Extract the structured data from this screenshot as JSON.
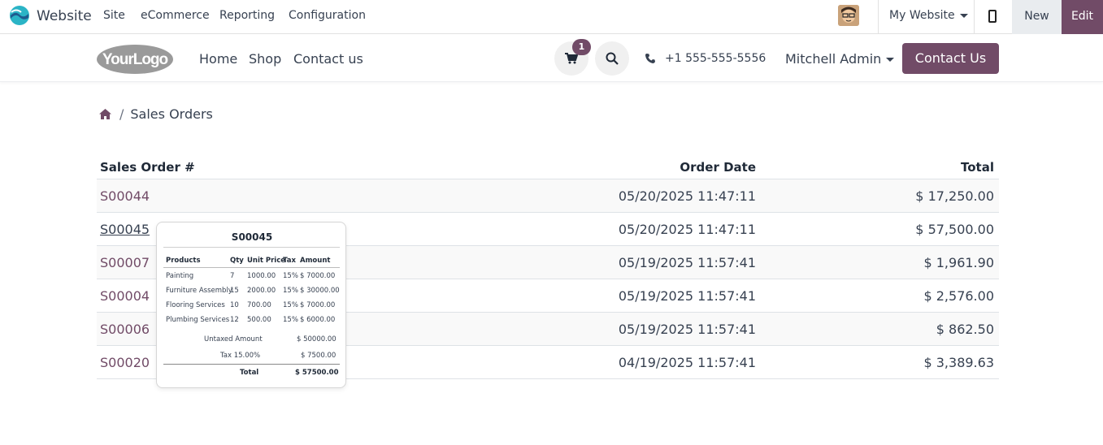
{
  "admin": {
    "app_name": "Website",
    "menu": [
      "Site",
      "eCommerce",
      "Reporting",
      "Configuration"
    ],
    "website_selector": "My Website",
    "new_label": "New",
    "edit_label": "Edit"
  },
  "header": {
    "logo_text": "YourLogo",
    "nav": [
      "Home",
      "Shop",
      "Contact us"
    ],
    "cart_count": "1",
    "phone": "+1 555-555-5556",
    "user": "Mitchell Admin",
    "contact_button": "Contact Us"
  },
  "breadcrumb": {
    "current": "Sales Orders"
  },
  "table": {
    "headers": [
      "Sales Order #",
      "Order Date",
      "Total"
    ],
    "rows": [
      {
        "order": "S00044",
        "date": "05/20/2025  11:47:11",
        "total": "$ 17,250.00"
      },
      {
        "order": "S00045",
        "date": "05/20/2025  11:47:11",
        "total": "$ 57,500.00"
      },
      {
        "order": "S00007",
        "date": "05/19/2025  11:57:41",
        "total": "$ 1,961.90"
      },
      {
        "order": "S00004",
        "date": "05/19/2025  11:57:41",
        "total": "$ 2,576.00"
      },
      {
        "order": "S00006",
        "date": "05/19/2025  11:57:41",
        "total": "$ 862.50"
      },
      {
        "order": "S00020",
        "date": "04/19/2025  11:57:41",
        "total": "$ 3,389.63"
      }
    ]
  },
  "popover": {
    "title": "S00045",
    "headers": [
      "Products",
      "Qty",
      "Unit Price",
      "Tax",
      "Amount"
    ],
    "lines": [
      {
        "product": "Painting",
        "qty": "7",
        "price": "1000.00",
        "tax": "15%",
        "amount": "$ 7000.00"
      },
      {
        "product": "Furniture Assembly",
        "qty": "15",
        "price": "2000.00",
        "tax": "15%",
        "amount": "$ 30000.00"
      },
      {
        "product": "Flooring Services",
        "qty": "10",
        "price": "700.00",
        "tax": "15%",
        "amount": "$ 7000.00"
      },
      {
        "product": "Plumbing Services",
        "qty": "12",
        "price": "500.00",
        "tax": "15%",
        "amount": "$ 6000.00"
      }
    ],
    "untaxed_label": "Untaxed Amount",
    "untaxed_value": "$ 50000.00",
    "tax_label": "Tax 15.00%",
    "tax_value": "$ 7500.00",
    "total_label": "Total",
    "total_value": "$ 57500.00"
  },
  "colors": {
    "brand": "#714b67",
    "text": "#374151"
  }
}
